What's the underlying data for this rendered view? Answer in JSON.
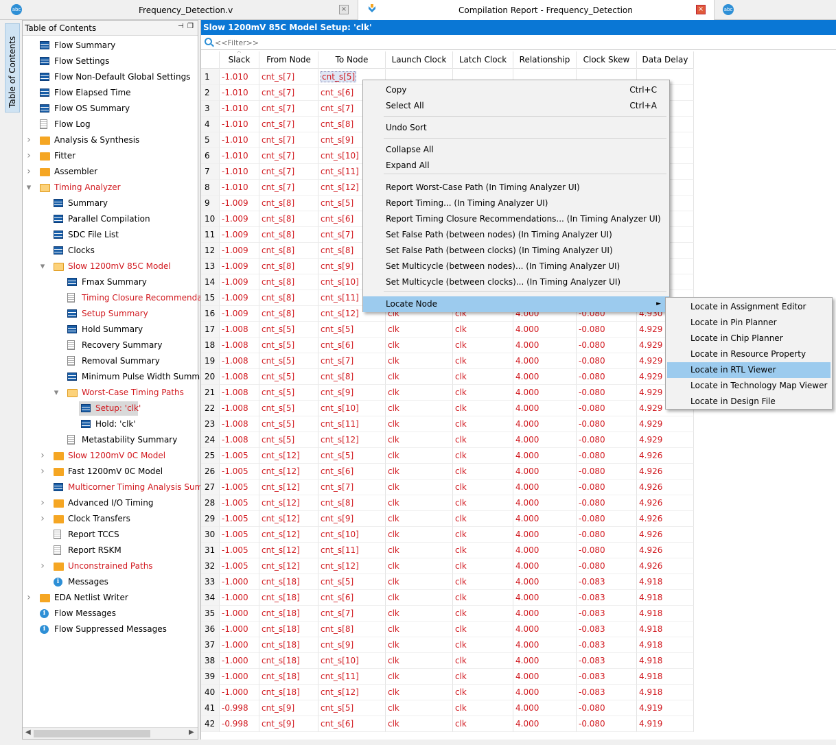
{
  "tabs": [
    {
      "title": "Frequency_Detection.v",
      "icon": "abc"
    },
    {
      "title": "Compilation Report - Frequency_Detection"
    },
    {
      "icon": "abc"
    }
  ],
  "sidebar": {
    "vertical_tab": "Table of Contents"
  },
  "toc": {
    "title": "Table of Contents",
    "items": [
      {
        "label": "Flow Summary",
        "icon": "table-icon"
      },
      {
        "label": "Flow Settings",
        "icon": "table-icon"
      },
      {
        "label": "Flow Non-Default Global Settings",
        "icon": "table-icon"
      },
      {
        "label": "Flow Elapsed Time",
        "icon": "table-icon"
      },
      {
        "label": "Flow OS Summary",
        "icon": "table-icon"
      },
      {
        "label": "Flow Log",
        "icon": "document-icon"
      },
      {
        "label": "Analysis & Synthesis",
        "icon": "folder-icon"
      },
      {
        "label": "Fitter",
        "icon": "folder-icon"
      },
      {
        "label": "Assembler",
        "icon": "folder-icon"
      },
      {
        "label": "Timing Analyzer",
        "icon": "open-folder-icon"
      },
      {
        "label": "Summary",
        "icon": "table-icon"
      },
      {
        "label": "Parallel Compilation",
        "icon": "table-icon"
      },
      {
        "label": "SDC File List",
        "icon": "table-icon"
      },
      {
        "label": "Clocks",
        "icon": "table-icon"
      },
      {
        "label": "Slow 1200mV 85C Model",
        "icon": "open-folder-icon"
      },
      {
        "label": "Fmax Summary",
        "icon": "table-icon"
      },
      {
        "label": "Timing Closure Recommendatio",
        "icon": "document-icon"
      },
      {
        "label": "Setup Summary",
        "icon": "table-icon"
      },
      {
        "label": "Hold Summary",
        "icon": "table-icon"
      },
      {
        "label": "Recovery Summary",
        "icon": "document-icon"
      },
      {
        "label": "Removal Summary",
        "icon": "document-icon"
      },
      {
        "label": "Minimum Pulse Width Summar",
        "icon": "table-icon"
      },
      {
        "label": "Worst-Case Timing Paths",
        "icon": "open-folder-icon"
      },
      {
        "label": "Setup: 'clk'",
        "icon": "table-icon"
      },
      {
        "label": "Hold: 'clk'",
        "icon": "table-icon"
      },
      {
        "label": "Metastability Summary",
        "icon": "document-icon"
      },
      {
        "label": "Slow 1200mV 0C Model",
        "icon": "folder-icon"
      },
      {
        "label": "Fast 1200mV 0C Model",
        "icon": "folder-icon"
      },
      {
        "label": "Multicorner Timing Analysis Summ",
        "icon": "table-icon"
      },
      {
        "label": "Advanced I/O Timing",
        "icon": "folder-icon"
      },
      {
        "label": "Clock Transfers",
        "icon": "folder-icon"
      },
      {
        "label": "Report TCCS",
        "icon": "document-icon"
      },
      {
        "label": "Report RSKM",
        "icon": "document-icon"
      },
      {
        "label": "Unconstrained Paths",
        "icon": "folder-icon"
      },
      {
        "label": "Messages",
        "icon": "info-icon"
      },
      {
        "label": "EDA Netlist Writer",
        "icon": "folder-icon"
      },
      {
        "label": "Flow Messages",
        "icon": "info-icon"
      },
      {
        "label": "Flow Suppressed Messages",
        "icon": "info-icon"
      }
    ]
  },
  "report": {
    "title": "Slow 1200mV 85C Model Setup: 'clk'",
    "filter_placeholder": "<<Filter>>",
    "columns": [
      "",
      "Slack",
      "From Node",
      "To Node",
      "Launch Clock",
      "Latch Clock",
      "Relationship",
      "Clock Skew",
      "Data Delay"
    ],
    "rows": [
      [
        "1",
        "-1.010",
        "cnt_s[7]",
        "cnt_s[5]",
        "",
        "",
        "",
        "",
        ""
      ],
      [
        "2",
        "-1.010",
        "cnt_s[7]",
        "cnt_s[6]",
        "",
        "",
        "",
        "",
        ""
      ],
      [
        "3",
        "-1.010",
        "cnt_s[7]",
        "cnt_s[7]",
        "",
        "",
        "",
        "",
        ""
      ],
      [
        "4",
        "-1.010",
        "cnt_s[7]",
        "cnt_s[8]",
        "",
        "",
        "",
        "",
        ""
      ],
      [
        "5",
        "-1.010",
        "cnt_s[7]",
        "cnt_s[9]",
        "",
        "",
        "",
        "",
        ""
      ],
      [
        "6",
        "-1.010",
        "cnt_s[7]",
        "cnt_s[10]",
        "",
        "",
        "",
        "",
        ""
      ],
      [
        "7",
        "-1.010",
        "cnt_s[7]",
        "cnt_s[11]",
        "",
        "",
        "",
        "",
        ""
      ],
      [
        "8",
        "-1.010",
        "cnt_s[7]",
        "cnt_s[12]",
        "",
        "",
        "",
        "",
        ""
      ],
      [
        "9",
        "-1.009",
        "cnt_s[8]",
        "cnt_s[5]",
        "",
        "",
        "",
        "",
        ""
      ],
      [
        "10",
        "-1.009",
        "cnt_s[8]",
        "cnt_s[6]",
        "",
        "",
        "",
        "",
        ""
      ],
      [
        "11",
        "-1.009",
        "cnt_s[8]",
        "cnt_s[7]",
        "",
        "",
        "",
        "",
        ""
      ],
      [
        "12",
        "-1.009",
        "cnt_s[8]",
        "cnt_s[8]",
        "",
        "",
        "",
        "",
        ""
      ],
      [
        "13",
        "-1.009",
        "cnt_s[8]",
        "cnt_s[9]",
        "",
        "",
        "",
        "",
        ""
      ],
      [
        "14",
        "-1.009",
        "cnt_s[8]",
        "cnt_s[10]",
        "",
        "",
        "",
        "",
        ""
      ],
      [
        "15",
        "-1.009",
        "cnt_s[8]",
        "cnt_s[11]",
        "",
        "",
        "",
        "",
        ""
      ],
      [
        "16",
        "-1.009",
        "cnt_s[8]",
        "cnt_s[12]",
        "clk",
        "clk",
        "4.000",
        "-0.080",
        "4.930"
      ],
      [
        "17",
        "-1.008",
        "cnt_s[5]",
        "cnt_s[5]",
        "clk",
        "clk",
        "4.000",
        "-0.080",
        "4.929"
      ],
      [
        "18",
        "-1.008",
        "cnt_s[5]",
        "cnt_s[6]",
        "clk",
        "clk",
        "4.000",
        "-0.080",
        "4.929"
      ],
      [
        "19",
        "-1.008",
        "cnt_s[5]",
        "cnt_s[7]",
        "clk",
        "clk",
        "4.000",
        "-0.080",
        "4.929"
      ],
      [
        "20",
        "-1.008",
        "cnt_s[5]",
        "cnt_s[8]",
        "clk",
        "clk",
        "4.000",
        "-0.080",
        "4.929"
      ],
      [
        "21",
        "-1.008",
        "cnt_s[5]",
        "cnt_s[9]",
        "clk",
        "clk",
        "4.000",
        "-0.080",
        "4.929"
      ],
      [
        "22",
        "-1.008",
        "cnt_s[5]",
        "cnt_s[10]",
        "clk",
        "clk",
        "4.000",
        "-0.080",
        "4.929"
      ],
      [
        "23",
        "-1.008",
        "cnt_s[5]",
        "cnt_s[11]",
        "clk",
        "clk",
        "4.000",
        "-0.080",
        "4.929"
      ],
      [
        "24",
        "-1.008",
        "cnt_s[5]",
        "cnt_s[12]",
        "clk",
        "clk",
        "4.000",
        "-0.080",
        "4.929"
      ],
      [
        "25",
        "-1.005",
        "cnt_s[12]",
        "cnt_s[5]",
        "clk",
        "clk",
        "4.000",
        "-0.080",
        "4.926"
      ],
      [
        "26",
        "-1.005",
        "cnt_s[12]",
        "cnt_s[6]",
        "clk",
        "clk",
        "4.000",
        "-0.080",
        "4.926"
      ],
      [
        "27",
        "-1.005",
        "cnt_s[12]",
        "cnt_s[7]",
        "clk",
        "clk",
        "4.000",
        "-0.080",
        "4.926"
      ],
      [
        "28",
        "-1.005",
        "cnt_s[12]",
        "cnt_s[8]",
        "clk",
        "clk",
        "4.000",
        "-0.080",
        "4.926"
      ],
      [
        "29",
        "-1.005",
        "cnt_s[12]",
        "cnt_s[9]",
        "clk",
        "clk",
        "4.000",
        "-0.080",
        "4.926"
      ],
      [
        "30",
        "-1.005",
        "cnt_s[12]",
        "cnt_s[10]",
        "clk",
        "clk",
        "4.000",
        "-0.080",
        "4.926"
      ],
      [
        "31",
        "-1.005",
        "cnt_s[12]",
        "cnt_s[11]",
        "clk",
        "clk",
        "4.000",
        "-0.080",
        "4.926"
      ],
      [
        "32",
        "-1.005",
        "cnt_s[12]",
        "cnt_s[12]",
        "clk",
        "clk",
        "4.000",
        "-0.080",
        "4.926"
      ],
      [
        "33",
        "-1.000",
        "cnt_s[18]",
        "cnt_s[5]",
        "clk",
        "clk",
        "4.000",
        "-0.083",
        "4.918"
      ],
      [
        "34",
        "-1.000",
        "cnt_s[18]",
        "cnt_s[6]",
        "clk",
        "clk",
        "4.000",
        "-0.083",
        "4.918"
      ],
      [
        "35",
        "-1.000",
        "cnt_s[18]",
        "cnt_s[7]",
        "clk",
        "clk",
        "4.000",
        "-0.083",
        "4.918"
      ],
      [
        "36",
        "-1.000",
        "cnt_s[18]",
        "cnt_s[8]",
        "clk",
        "clk",
        "4.000",
        "-0.083",
        "4.918"
      ],
      [
        "37",
        "-1.000",
        "cnt_s[18]",
        "cnt_s[9]",
        "clk",
        "clk",
        "4.000",
        "-0.083",
        "4.918"
      ],
      [
        "38",
        "-1.000",
        "cnt_s[18]",
        "cnt_s[10]",
        "clk",
        "clk",
        "4.000",
        "-0.083",
        "4.918"
      ],
      [
        "39",
        "-1.000",
        "cnt_s[18]",
        "cnt_s[11]",
        "clk",
        "clk",
        "4.000",
        "-0.083",
        "4.918"
      ],
      [
        "40",
        "-1.000",
        "cnt_s[18]",
        "cnt_s[12]",
        "clk",
        "clk",
        "4.000",
        "-0.083",
        "4.918"
      ],
      [
        "41",
        "-0.998",
        "cnt_s[9]",
        "cnt_s[5]",
        "clk",
        "clk",
        "4.000",
        "-0.080",
        "4.919"
      ],
      [
        "42",
        "-0.998",
        "cnt_s[9]",
        "cnt_s[6]",
        "clk",
        "clk",
        "4.000",
        "-0.080",
        "4.919"
      ]
    ]
  },
  "context_menu": {
    "items": [
      {
        "label": "Copy",
        "shortcut": "Ctrl+C"
      },
      {
        "label": "Select All",
        "shortcut": "Ctrl+A"
      },
      {
        "label": "Undo Sort"
      },
      {
        "label": "Collapse All"
      },
      {
        "label": "Expand All"
      },
      {
        "label": "Report Worst-Case Path (In Timing Analyzer UI)"
      },
      {
        "label": "Report Timing... (In Timing Analyzer UI)"
      },
      {
        "label": "Report Timing Closure Recommendations... (In Timing Analyzer UI)"
      },
      {
        "label": "Set False Path (between nodes) (In Timing Analyzer UI)"
      },
      {
        "label": "Set False Path (between clocks) (In Timing Analyzer UI)"
      },
      {
        "label": "Set Multicycle (between nodes)... (In Timing Analyzer UI)"
      },
      {
        "label": "Set Multicycle (between clocks)... (In Timing Analyzer UI)"
      },
      {
        "label": "Locate Node",
        "arrow": "►"
      }
    ]
  },
  "submenu": {
    "items": [
      "Locate in Assignment Editor",
      "Locate in Pin Planner",
      "Locate in Chip Planner",
      "Locate in Resource Property Editor",
      "Locate in RTL Viewer",
      "Locate in Technology Map Viewer",
      "Locate in Design File"
    ]
  },
  "colors": {
    "accent": "#0a77d5",
    "red_text": "#d1191f",
    "menu_highlight": "#9ccbee"
  }
}
